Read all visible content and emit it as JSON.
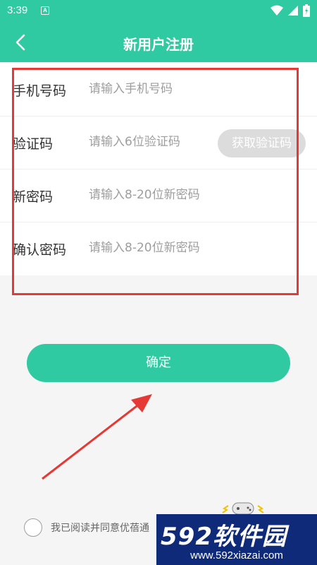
{
  "statusbar": {
    "time": "3:39",
    "notif_badge": "A"
  },
  "appbar": {
    "title": "新用户注册"
  },
  "form": {
    "phone": {
      "label": "手机号码",
      "placeholder": "请输入手机号码"
    },
    "code": {
      "label": "验证码",
      "placeholder": "请输入6位验证码",
      "button": "获取验证码"
    },
    "new_password": {
      "label": "新密码",
      "placeholder": "请输入8-20位新密码"
    },
    "confirm_password": {
      "label": "确认密码",
      "placeholder": "请输入8-20位新密码"
    }
  },
  "confirm_button": "确定",
  "agreement": {
    "text": "我已阅读并同意优蓓通"
  },
  "watermark": {
    "brand_num": "592",
    "brand_text": "软件园",
    "url": "www.592xiazai.com"
  },
  "colors": {
    "primary": "#2fc9a2",
    "highlight": "#e53935",
    "watermark_bg": "#0f2a78"
  }
}
